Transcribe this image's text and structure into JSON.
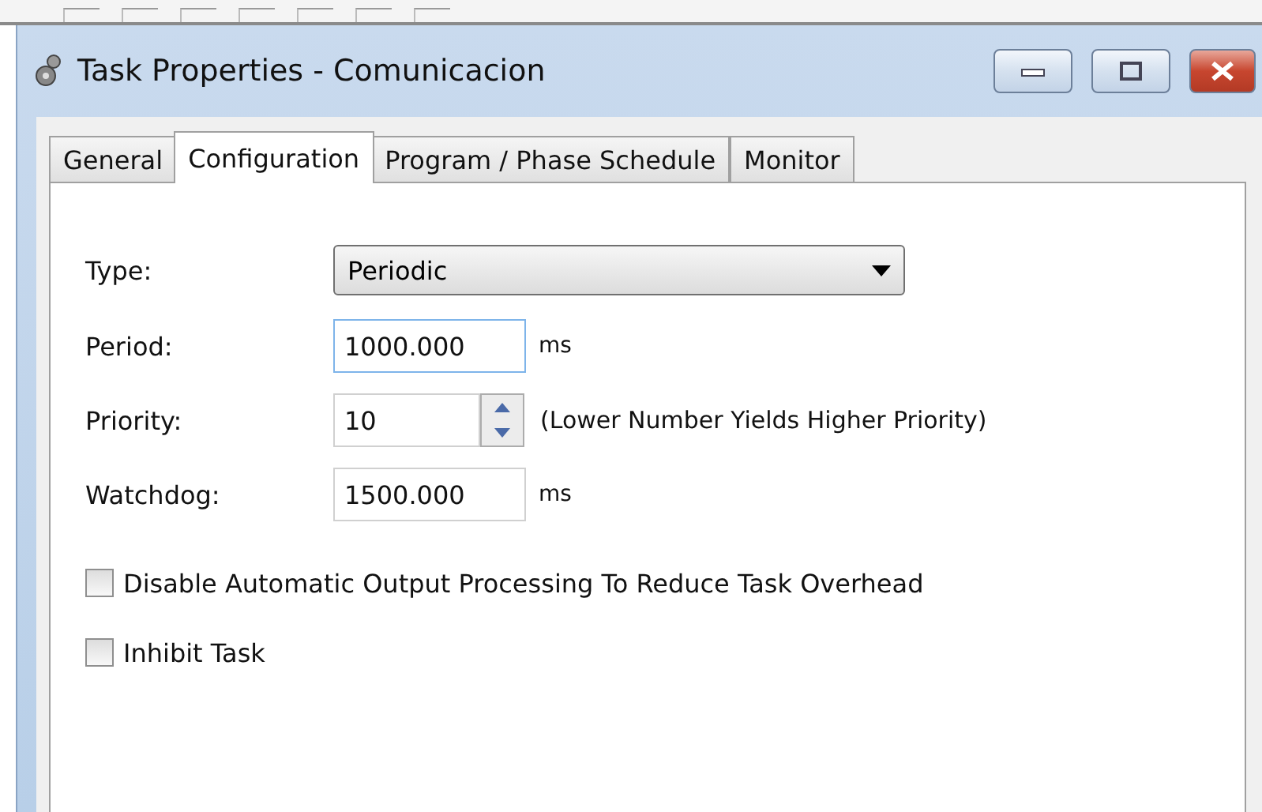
{
  "window": {
    "title": "Task Properties - Comunicacion"
  },
  "tabs": [
    {
      "label": "General",
      "selected": false
    },
    {
      "label": "Configuration",
      "selected": true
    },
    {
      "label": "Program / Phase Schedule",
      "selected": false
    },
    {
      "label": "Monitor",
      "selected": false
    }
  ],
  "fields": [
    {
      "kind": "dropdown",
      "label": "Type:",
      "value": "Periodic"
    },
    {
      "kind": "text",
      "label": "Period:",
      "value": "1000.000",
      "unit": "ms",
      "focused": true
    },
    {
      "kind": "spinner",
      "label": "Priority:",
      "value": "10",
      "note": "(Lower Number Yields Higher Priority)"
    },
    {
      "kind": "text",
      "label": "Watchdog:",
      "value": "1500.000",
      "unit": "ms",
      "focused": false
    }
  ],
  "checkboxes": [
    {
      "label": "Disable Automatic Output Processing To Reduce Task Overhead",
      "checked": false
    },
    {
      "label": "Inhibit Task",
      "checked": false
    }
  ]
}
